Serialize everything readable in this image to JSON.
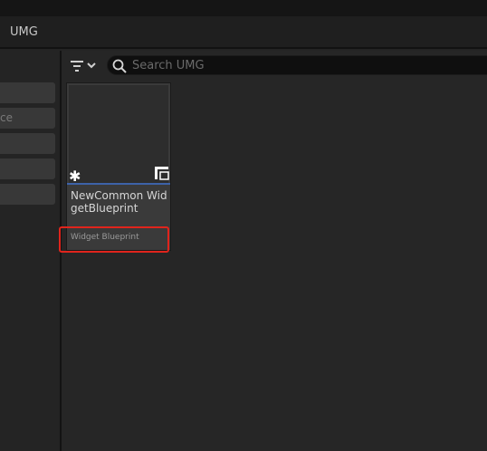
{
  "header": {
    "title": "UMG"
  },
  "left_panel": {
    "items": [
      {
        "label": ""
      },
      {
        "label": "ce"
      },
      {
        "label": ""
      },
      {
        "label": ""
      },
      {
        "label": ""
      }
    ]
  },
  "toolbar": {
    "filter_icon": "filter-icon",
    "search_placeholder": "Search UMG",
    "search_value": ""
  },
  "assets": [
    {
      "name": "NewCommon WidgetBlueprint",
      "type": "Widget Blueprint",
      "accent_color": "#3d62a8"
    }
  ],
  "colors": {
    "highlight": "#e0241c",
    "accent": "#3d62a8"
  }
}
